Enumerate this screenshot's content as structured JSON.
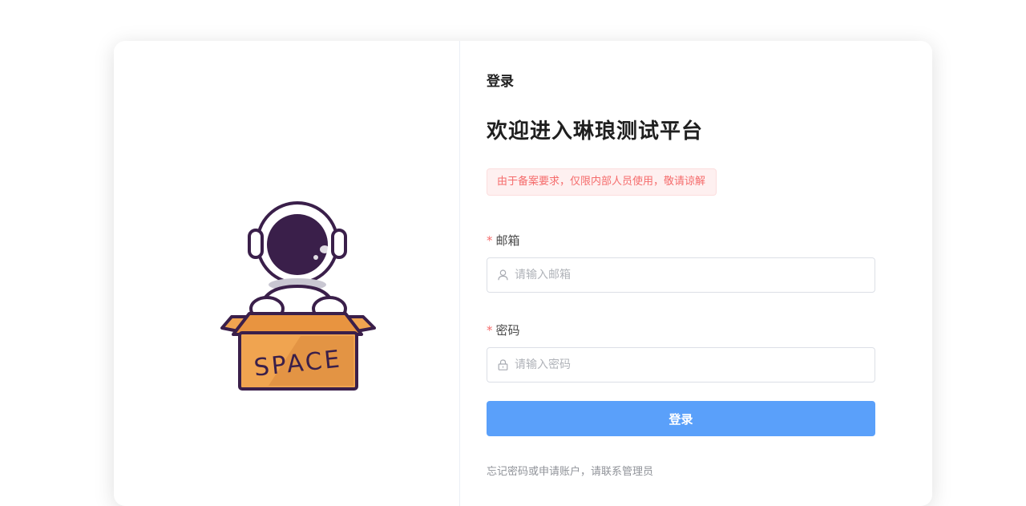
{
  "form": {
    "header": "登录",
    "welcome": "欢迎进入琳琅测试平台",
    "notice": "由于备案要求，仅限内部人员使用，敬请谅解",
    "email": {
      "required_mark": "*",
      "label": "邮箱",
      "placeholder": "请输入邮箱",
      "value": "",
      "icon": "user-icon"
    },
    "password": {
      "required_mark": "*",
      "label": "密码",
      "placeholder": "请输入密码",
      "value": "",
      "icon": "lock-icon"
    },
    "submit_label": "登录",
    "footer_hint": "忘记密码或申请账户，请联系管理员"
  },
  "illustration": {
    "box_text": "SPACE",
    "name": "astronaut-in-box"
  },
  "colors": {
    "primary_button": "#5aa0fa",
    "notice_text": "#f56c6c",
    "notice_bg": "#fef0f0",
    "box_orange": "#f0a450",
    "helmet_purple": "#3a1f4a"
  }
}
